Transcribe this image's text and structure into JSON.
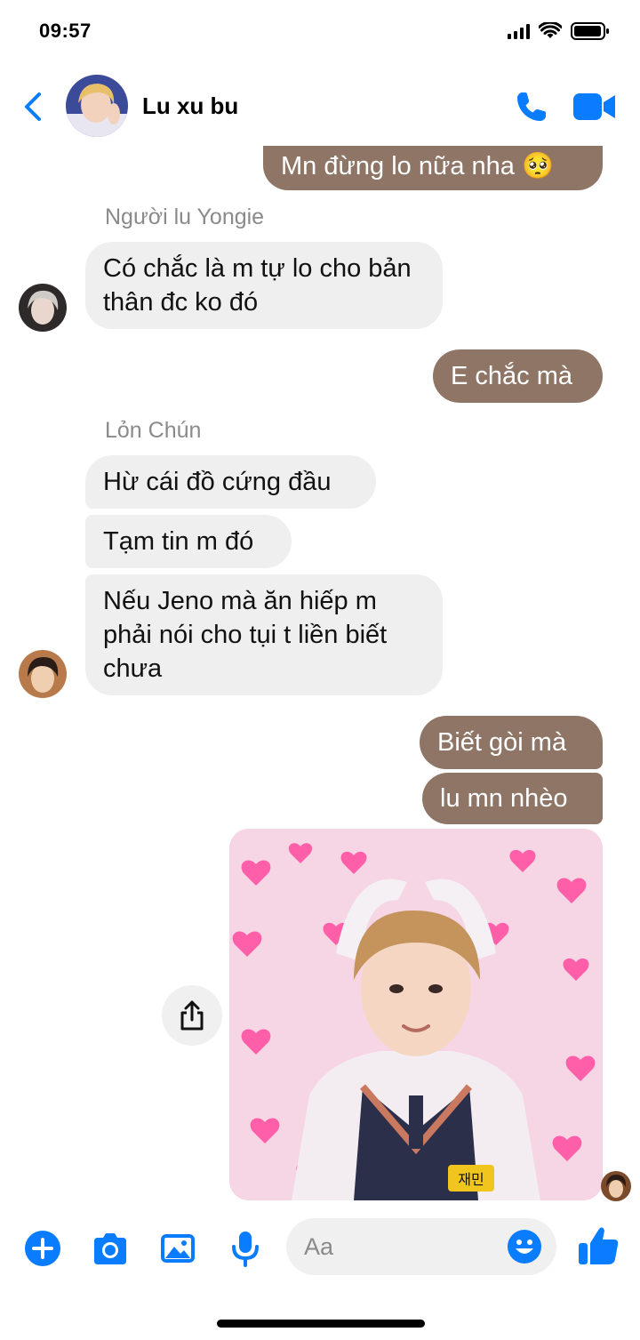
{
  "status_bar": {
    "time": "09:57"
  },
  "header": {
    "title": "Lu xu bu"
  },
  "messages": [
    {
      "text": "Mn đừng lo nữa nha 🥺"
    },
    {
      "sender": "Người lu Yongie"
    },
    {
      "text": "Có chắc là m tự lo cho bản thân đc ko đó"
    },
    {
      "text": "E chắc mà"
    },
    {
      "sender": "Lỏn Chún"
    },
    {
      "text": "Hừ cái đồ cứng đầu"
    },
    {
      "text": "Tạm tin m đó"
    },
    {
      "text": "Nếu Jeno mà ăn hiếp m phải nói cho tụi t liền biết chưa"
    },
    {
      "text": "Biết gòi mà"
    },
    {
      "text": "lu mn nhèo"
    }
  ],
  "photo": {
    "badge_text": "재민"
  },
  "composer": {
    "placeholder": "Aa"
  },
  "colors": {
    "accent": "#0a7cff",
    "outgoing_bubble": "#8f7566",
    "incoming_bubble": "#efefef"
  },
  "icons": [
    "back-chevron-icon",
    "phone-icon",
    "video-camera-icon",
    "share-icon",
    "plus-icon",
    "camera-icon",
    "image-icon",
    "microphone-icon",
    "emoji-icon",
    "thumbs-up-icon"
  ]
}
